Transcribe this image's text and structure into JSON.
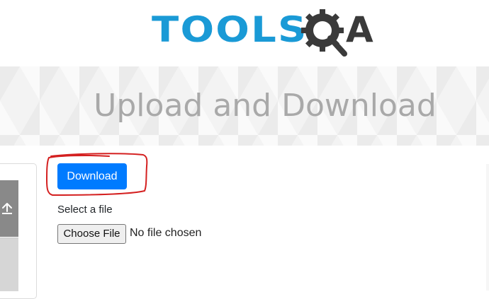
{
  "logo": {
    "text": "TOOLS",
    "letter": "A",
    "icon": "gear-magnifier-icon",
    "colors": {
      "primary": "#1a9ad6",
      "dark": "#3a3a3a"
    }
  },
  "banner": {
    "title": "Upload and Download"
  },
  "sidebar": {
    "active_icon": "upload-icon"
  },
  "main": {
    "download_label": "Download",
    "select_label": "Select a file",
    "choose_file_label": "Choose File",
    "no_file_text": "No file chosen"
  },
  "colors": {
    "accent": "#007bff",
    "annotation": "#d42020"
  }
}
